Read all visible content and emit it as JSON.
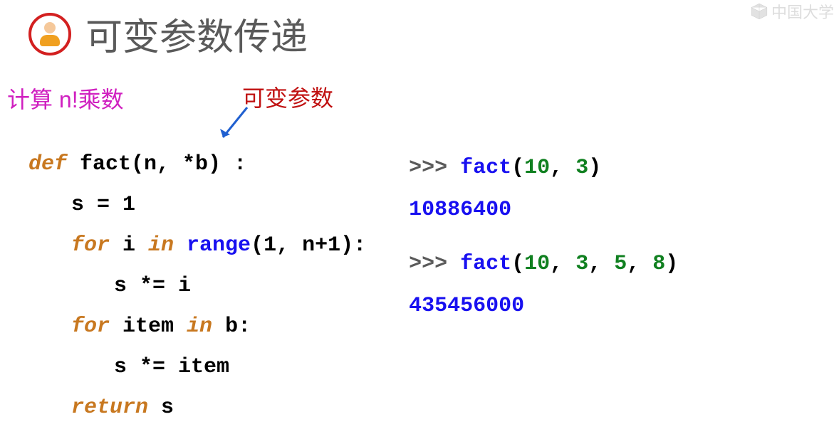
{
  "header": {
    "title": "可变参数传递"
  },
  "watermark": {
    "text": "中国大学"
  },
  "subtitle": "计算 n!乘数",
  "annotation": "可变参数",
  "code": {
    "def": "def",
    "fact": "fact",
    "sig_open": "(n, *b) :",
    "s_eq_1": "s = 1",
    "for1": "for",
    "i": " i ",
    "in1": "in",
    "range": " range",
    "range_args": "(1, n+1):",
    "s_times_i": "s *= i",
    "for2": "for",
    "item": " item ",
    "in2": "in",
    "b_colon": " b:",
    "s_times_item": "s *= item",
    "return": "return",
    "return_s": " s"
  },
  "repl": {
    "prompt": ">>> ",
    "fact_label": "fact",
    "call1_open": "(",
    "call1_a1": "10",
    "call1_sep1": ", ",
    "call1_a2": "3",
    "call1_close": ")",
    "result1": "10886400",
    "call2_open": "(",
    "call2_a1": "10",
    "call2_sep1": ", ",
    "call2_a2": "3",
    "call2_sep2": ", ",
    "call2_a3": "5",
    "call2_sep3": ", ",
    "call2_a4": "8",
    "call2_close": ")",
    "result2": "435456000"
  }
}
